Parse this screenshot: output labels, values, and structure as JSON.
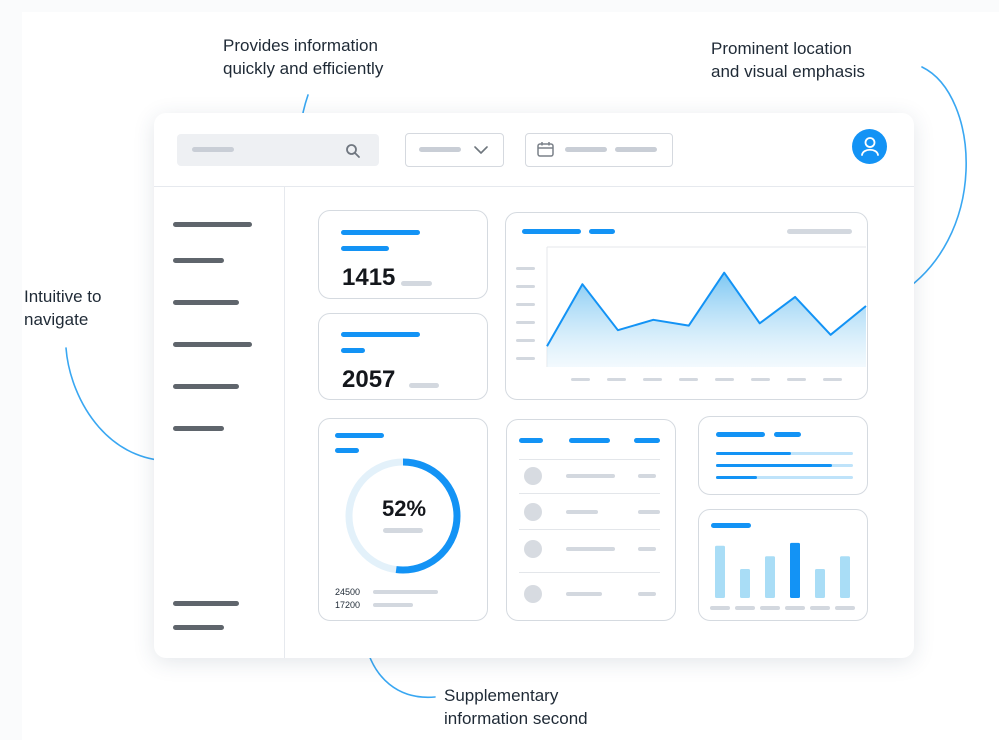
{
  "annotations": {
    "top_center": "Provides information\nquickly and efficiently",
    "top_right": "Prominent location\nand visual emphasis",
    "left": "Intuitive to\nnavigate",
    "bottom": "Supplementary\ninformation second"
  },
  "icons": {
    "search": "search-icon",
    "dropdown": "chevron-down-icon",
    "date": "calendar-icon",
    "user": "user-icon"
  },
  "colors": {
    "accent": "#1393f5",
    "arrow": "#39a7f2",
    "placeholder": "#c9ced6",
    "nav_item": "#5f656c"
  },
  "dashboard": {
    "kpi1": {
      "value": "1415"
    },
    "kpi2": {
      "value": "2057"
    },
    "donut": {
      "percent_label": "52%",
      "percent": 52,
      "legend_values": [
        "24500",
        "17200"
      ]
    },
    "area_chart": {
      "points": [
        0.18,
        0.72,
        0.32,
        0.41,
        0.36,
        0.82,
        0.38,
        0.61,
        0.28,
        0.53
      ]
    },
    "progress_bars": [
      0.55,
      0.85,
      0.3
    ],
    "mini_bars": [
      {
        "level": 0.9,
        "highlight": false
      },
      {
        "level": 0.5,
        "highlight": false
      },
      {
        "level": 0.72,
        "highlight": false
      },
      {
        "level": 0.95,
        "highlight": true
      },
      {
        "level": 0.5,
        "highlight": false
      },
      {
        "level": 0.72,
        "highlight": false
      }
    ]
  }
}
